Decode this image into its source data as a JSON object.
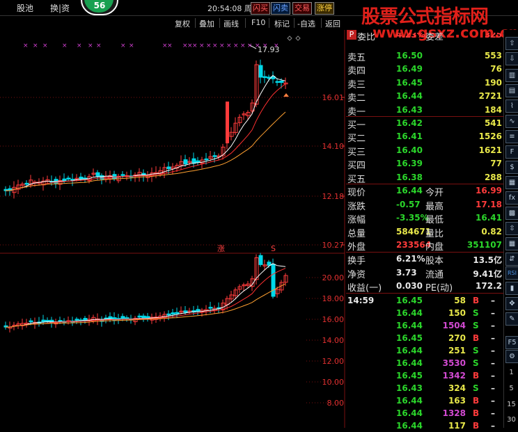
{
  "topbar": {
    "tabs": [
      "股池",
      "换|资"
    ],
    "badge": "56",
    "clock": "20:54:08 周六",
    "buttons": [
      {
        "label": "闪买",
        "color": "#ff6060",
        "bg": "#3a0000"
      },
      {
        "label": "闪卖",
        "color": "#6aa0ff",
        "bg": "#001a3a"
      },
      {
        "label": "交易",
        "color": "#ff6060",
        "bg": "#3a0000"
      },
      {
        "label": "涨停",
        "color": "#ffd040",
        "bg": "#3a2a00"
      }
    ]
  },
  "watermark": {
    "line1": "股票公式指标网",
    "line2": "www.gsxz.com.cn"
  },
  "toolbar": [
    "复权",
    "叠加",
    "画线",
    "F10",
    "标记",
    "-自选",
    "返回"
  ],
  "chart": {
    "price_axis": [
      "16.01",
      "14.10",
      "12.18",
      "10.27"
    ],
    "volume_axis": [
      "20.00",
      "18.00",
      "16.00",
      "14.00",
      "12.00",
      "10.00",
      "8.00"
    ],
    "high_label": "17.93",
    "markers": [
      "涨",
      "S"
    ]
  },
  "quote_header": {
    "left_label": "委比",
    "left_value": "4.23%",
    "right_label": "委差",
    "right_value": "325"
  },
  "asks": [
    {
      "label": "卖五",
      "price": "16.50",
      "vol": "553"
    },
    {
      "label": "卖四",
      "price": "16.49",
      "vol": "76"
    },
    {
      "label": "卖三",
      "price": "16.45",
      "vol": "190"
    },
    {
      "label": "卖二",
      "price": "16.44",
      "vol": "2721"
    },
    {
      "label": "卖一",
      "price": "16.43",
      "vol": "184"
    }
  ],
  "bids": [
    {
      "label": "买一",
      "price": "16.42",
      "vol": "541"
    },
    {
      "label": "买二",
      "price": "16.41",
      "vol": "1526"
    },
    {
      "label": "买三",
      "price": "16.40",
      "vol": "1621"
    },
    {
      "label": "买四",
      "price": "16.39",
      "vol": "77"
    },
    {
      "label": "买五",
      "price": "16.38",
      "vol": "288"
    }
  ],
  "stats": [
    {
      "l1": "现价",
      "v1": "16.44",
      "c1": "g",
      "l2": "今开",
      "v2": "16.99",
      "c2": "r"
    },
    {
      "l1": "涨跌",
      "v1": "-0.57",
      "c1": "g",
      "l2": "最高",
      "v2": "17.18",
      "c2": "r"
    },
    {
      "l1": "涨幅",
      "v1": "-3.35%",
      "c1": "g",
      "l2": "最低",
      "v2": "16.41",
      "c2": "g"
    },
    {
      "l1": "总量",
      "v1": "584671",
      "c1": "y",
      "l2": "量比",
      "v2": "0.82",
      "c2": "y"
    },
    {
      "l1": "外盘",
      "v1": "233564",
      "c1": "r",
      "l2": "内盘",
      "v2": "351107",
      "c2": "g"
    }
  ],
  "finance": [
    {
      "l1": "换手",
      "v1": "6.21%",
      "l2": "股本",
      "v2": "13.5亿"
    },
    {
      "l1": "净资",
      "v1": "3.73",
      "l2": "流通",
      "v2": "9.41亿"
    },
    {
      "l1": "收益(一)",
      "v1": "0.030",
      "l2": "PE(动)",
      "v2": "172.2"
    }
  ],
  "ticks": [
    {
      "time": "14:59",
      "price": "16.45",
      "vol": "58",
      "side": "B",
      "vc": "y"
    },
    {
      "time": "",
      "price": "16.44",
      "vol": "150",
      "side": "S",
      "vc": "y"
    },
    {
      "time": "",
      "price": "16.44",
      "vol": "1504",
      "side": "S",
      "vc": "m"
    },
    {
      "time": "",
      "price": "16.45",
      "vol": "270",
      "side": "B",
      "vc": "y"
    },
    {
      "time": "",
      "price": "16.44",
      "vol": "251",
      "side": "S",
      "vc": "y"
    },
    {
      "time": "",
      "price": "16.44",
      "vol": "3530",
      "side": "S",
      "vc": "m"
    },
    {
      "time": "",
      "price": "16.45",
      "vol": "1342",
      "side": "B",
      "vc": "m"
    },
    {
      "time": "",
      "price": "16.43",
      "vol": "324",
      "side": "S",
      "vc": "y"
    },
    {
      "time": "",
      "price": "16.44",
      "vol": "163",
      "side": "B",
      "vc": "y"
    },
    {
      "time": "",
      "price": "16.44",
      "vol": "1328",
      "side": "B",
      "vc": "m"
    },
    {
      "time": "",
      "price": "16.44",
      "vol": "117",
      "side": "B",
      "vc": "y"
    }
  ],
  "side_numbers": [
    "1",
    "5",
    "15",
    "30"
  ],
  "p_badge": "P",
  "colors": {
    "up": "#ff3b3b",
    "down": "#00d8e8",
    "ma5": "#ffffff",
    "ma10": "#ff3030",
    "ma20": "#ffa030",
    "grid": "#7a1010",
    "marker": "#d040d0"
  }
}
